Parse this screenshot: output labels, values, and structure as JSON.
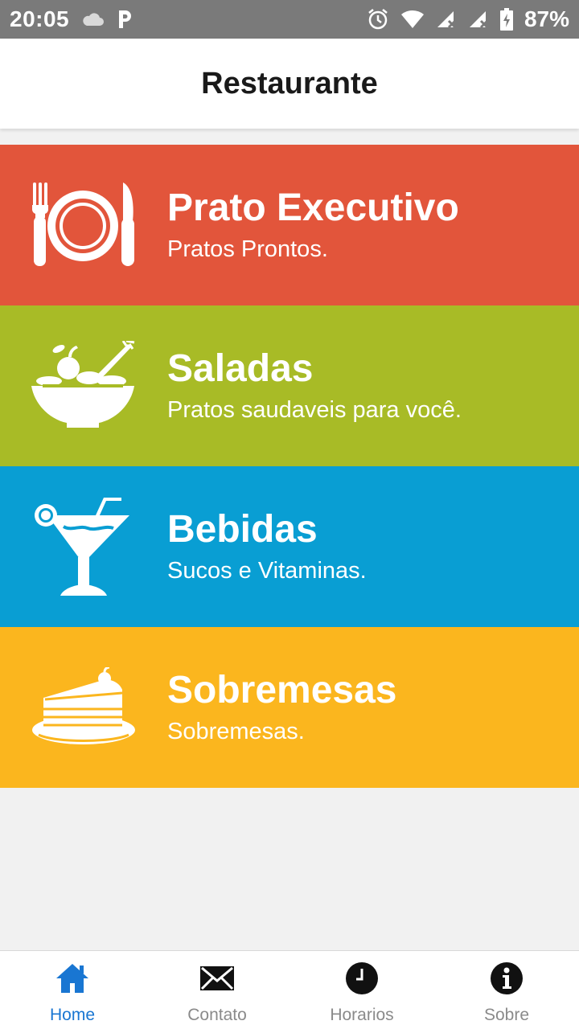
{
  "status_bar": {
    "time": "20:05",
    "battery_percent": "87%",
    "icons": [
      "cloud-icon",
      "parking-icon",
      "alarm-icon",
      "wifi-icon",
      "signal-icon",
      "signal-icon",
      "battery-charging-icon"
    ]
  },
  "header": {
    "title": "Restaurante"
  },
  "menu": {
    "items": [
      {
        "title": "Prato Executivo",
        "subtitle": "Pratos Prontos.",
        "color": "#e2553b",
        "icon": "plate-cutlery-icon"
      },
      {
        "title": "Saladas",
        "subtitle": "Pratos saudaveis para você.",
        "color": "#a8bb26",
        "icon": "salad-bowl-icon"
      },
      {
        "title": "Bebidas",
        "subtitle": "Sucos e Vitaminas.",
        "color": "#099ed3",
        "icon": "cocktail-icon"
      },
      {
        "title": "Sobremesas",
        "subtitle": "Sobremesas.",
        "color": "#fbb61e",
        "icon": "cake-icon"
      }
    ]
  },
  "bottom_nav": {
    "items": [
      {
        "label": "Home",
        "icon": "home-icon",
        "active": true
      },
      {
        "label": "Contato",
        "icon": "mail-icon",
        "active": false
      },
      {
        "label": "Horarios",
        "icon": "clock-icon",
        "active": false
      },
      {
        "label": "Sobre",
        "icon": "info-icon",
        "active": false
      }
    ]
  },
  "colors": {
    "active": "#1976d2",
    "inactive": "#8a8a8a",
    "background": "#f1f1f1",
    "status_bar": "#7a7a7a"
  }
}
